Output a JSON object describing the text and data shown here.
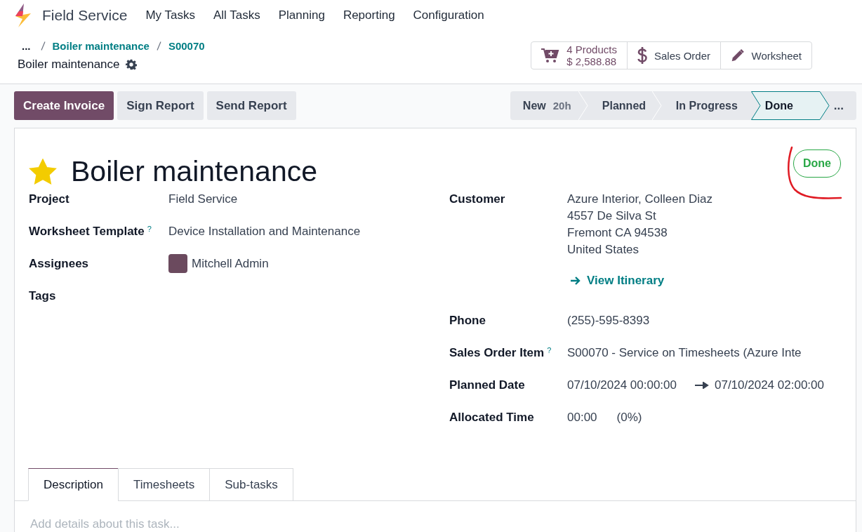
{
  "navbar": {
    "app_name": "Field Service",
    "menu": [
      "My Tasks",
      "All Tasks",
      "Planning",
      "Reporting",
      "Configuration"
    ]
  },
  "breadcrumbs": {
    "overflow": "...",
    "items": [
      "Boiler maintenance",
      "S00070"
    ],
    "current": "Boiler maintenance"
  },
  "stat_buttons": [
    {
      "kind": "products",
      "label": "4 Products",
      "value": "$ 2,588.88"
    },
    {
      "kind": "sales_order",
      "label": "Sales Order"
    },
    {
      "kind": "worksheet",
      "label": "Worksheet"
    }
  ],
  "actions": [
    {
      "label": "Create Invoice",
      "primary": true
    },
    {
      "label": "Sign Report",
      "primary": false
    },
    {
      "label": "Send Report",
      "primary": false
    }
  ],
  "stages": [
    {
      "label": "New",
      "duration": "20h",
      "selected": false
    },
    {
      "label": "Planned",
      "selected": false
    },
    {
      "label": "In Progress",
      "selected": false
    },
    {
      "label": "Done",
      "selected": true
    }
  ],
  "stages_more": "...",
  "record": {
    "favorite": true,
    "title": "Boiler maintenance",
    "status": "Done"
  },
  "left_fields": [
    {
      "kind": "text",
      "label": "Project",
      "value": "Field Service"
    },
    {
      "kind": "text",
      "label": "Worksheet Template",
      "help": "?",
      "value": "Device Installation and Maintenance"
    },
    {
      "kind": "user",
      "label": "Assignees",
      "value": "Mitchell Admin"
    },
    {
      "kind": "empty",
      "label": "Tags"
    }
  ],
  "right_fields": [
    {
      "kind": "address",
      "label": "Customer",
      "lines": [
        "Azure Interior, Colleen Diaz",
        "4557 De Silva St",
        "Fremont CA 94538",
        "United States"
      ],
      "link": "View Itinerary"
    },
    {
      "kind": "text",
      "label": "Phone",
      "value": "(255)-595-8393"
    },
    {
      "kind": "text",
      "label": "Sales Order Item",
      "help": "?",
      "value": "S00070 - Service on Timesheets (Azure Inte"
    },
    {
      "kind": "range",
      "label": "Planned Date",
      "start": "07/10/2024 00:00:00",
      "end": "07/10/2024 02:00:00"
    },
    {
      "kind": "time",
      "label": "Allocated Time",
      "value": "00:00",
      "percent": "(0%)"
    }
  ],
  "tabs": [
    {
      "label": "Description",
      "selected": true
    },
    {
      "label": "Timesheets",
      "selected": false
    },
    {
      "label": "Sub-tasks",
      "selected": false
    }
  ],
  "description": {
    "placeholder": "Add details about this task..."
  }
}
